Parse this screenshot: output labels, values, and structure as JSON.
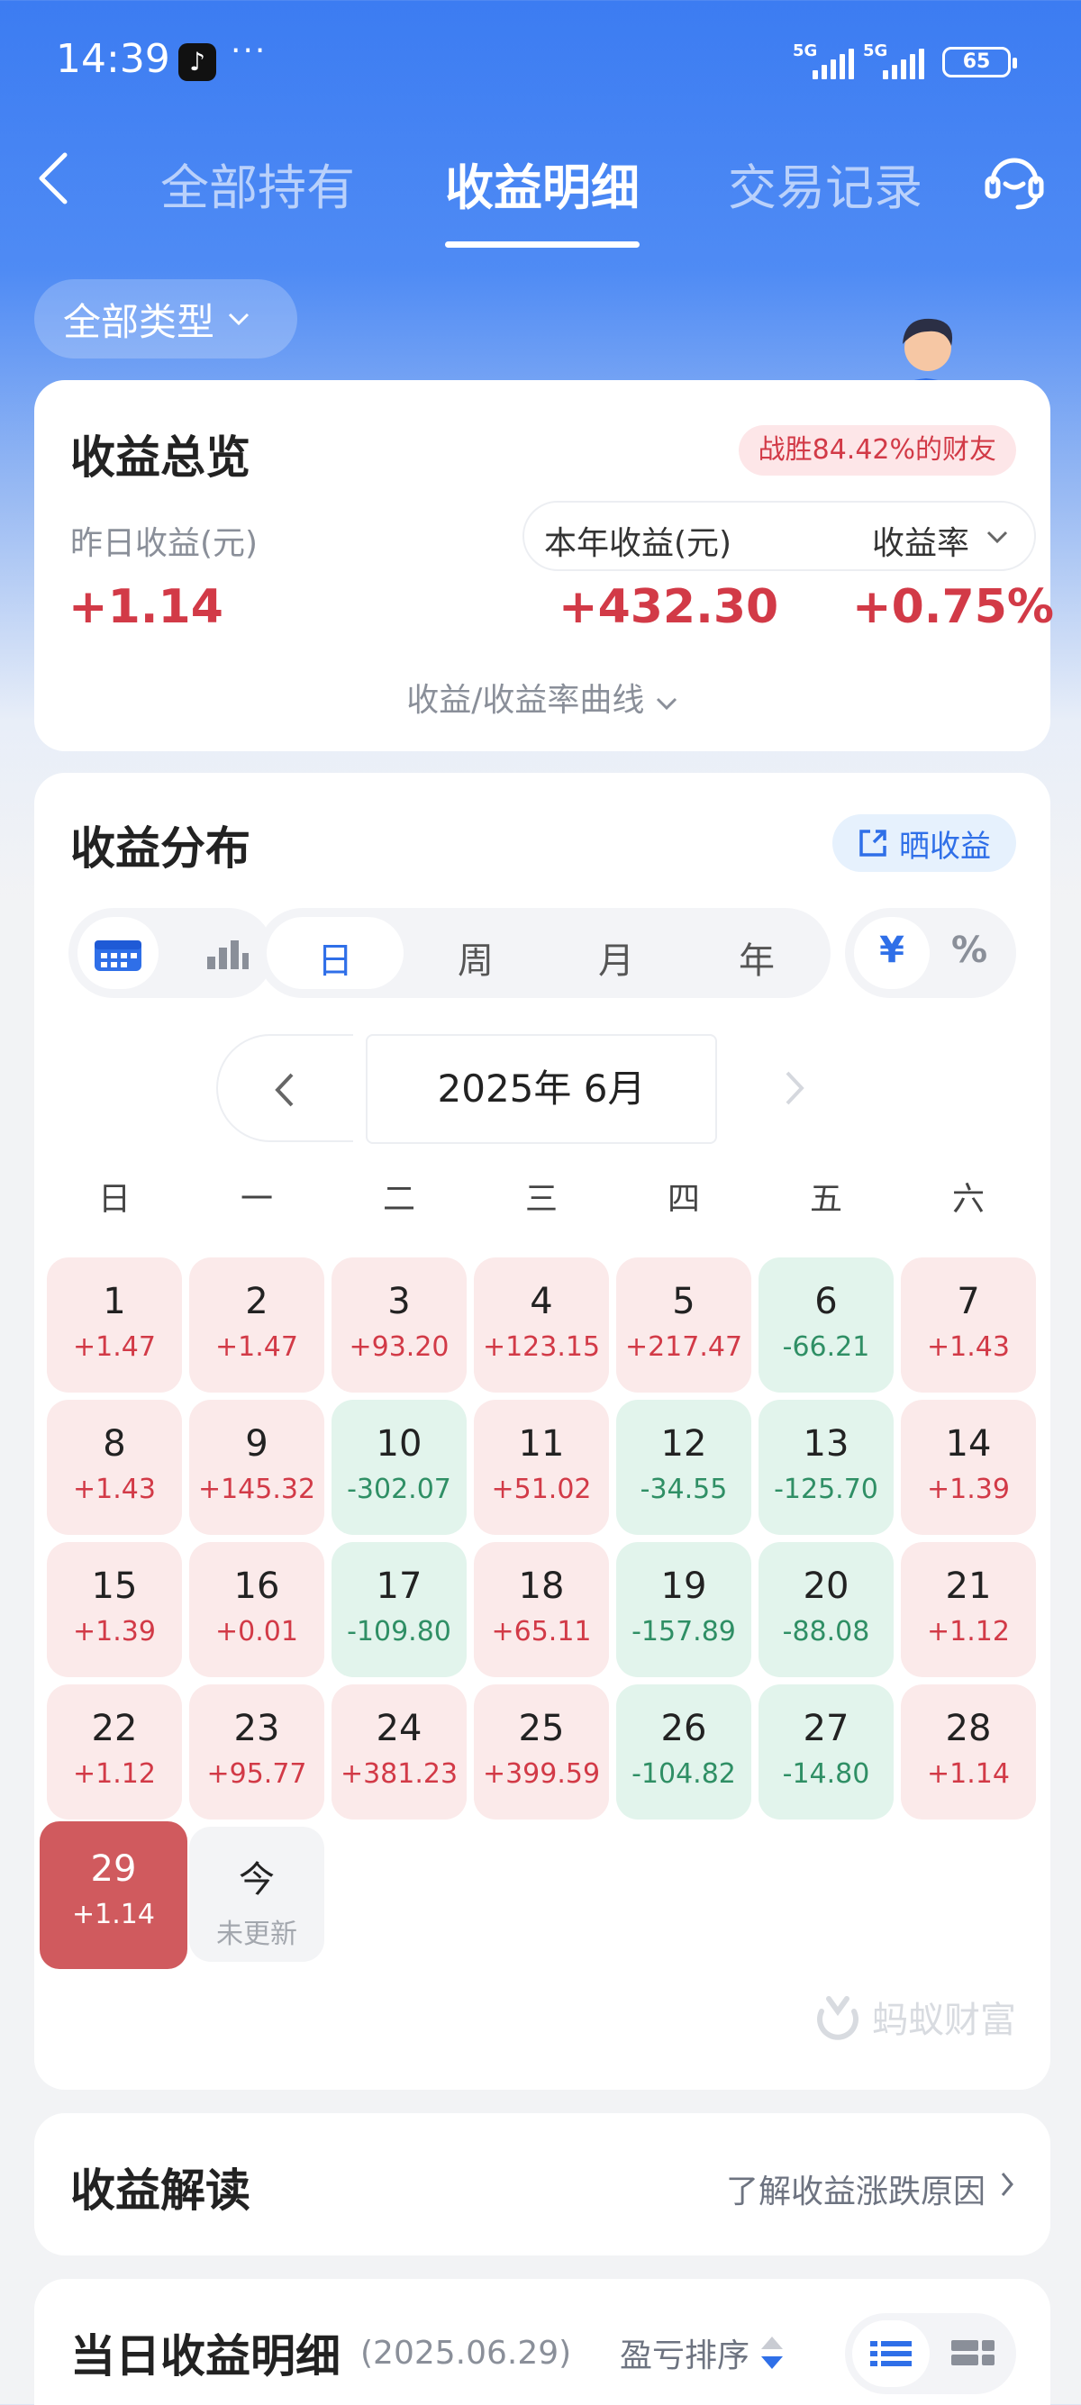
{
  "status_bar": {
    "time": "14:39",
    "dots": "···",
    "signal1": "5G",
    "signal2": "5G",
    "battery": "65"
  },
  "nav": {
    "tabs": [
      "全部持有",
      "收益明细",
      "交易记录"
    ],
    "active_index": 1
  },
  "type_filter": {
    "label": "全部类型"
  },
  "overview": {
    "title": "收益总览",
    "rank_badge": "战胜84.42%的财友",
    "yesterday_label": "昨日收益(元)",
    "yesterday_value": "+1.14",
    "year_label": "本年收益(元)",
    "year_value": "+432.30",
    "rate_label": "收益率",
    "rate_value": "+0.75%",
    "curve_label": "收益/收益率曲线"
  },
  "distribution": {
    "title": "收益分布",
    "share_label": "晒收益",
    "periods": [
      "日",
      "周",
      "月",
      "年"
    ],
    "active_period": "日",
    "units": [
      "¥",
      "%"
    ],
    "month_label": "2025年 6月",
    "weekdays": [
      "日",
      "一",
      "二",
      "三",
      "四",
      "五",
      "六"
    ],
    "days": [
      {
        "day": "1",
        "value": "+1.47",
        "trend": "pos"
      },
      {
        "day": "2",
        "value": "+1.47",
        "trend": "pos"
      },
      {
        "day": "3",
        "value": "+93.20",
        "trend": "pos"
      },
      {
        "day": "4",
        "value": "+123.15",
        "trend": "pos"
      },
      {
        "day": "5",
        "value": "+217.47",
        "trend": "pos"
      },
      {
        "day": "6",
        "value": "-66.21",
        "trend": "neg"
      },
      {
        "day": "7",
        "value": "+1.43",
        "trend": "pos"
      },
      {
        "day": "8",
        "value": "+1.43",
        "trend": "pos"
      },
      {
        "day": "9",
        "value": "+145.32",
        "trend": "pos"
      },
      {
        "day": "10",
        "value": "-302.07",
        "trend": "neg"
      },
      {
        "day": "11",
        "value": "+51.02",
        "trend": "pos"
      },
      {
        "day": "12",
        "value": "-34.55",
        "trend": "neg"
      },
      {
        "day": "13",
        "value": "-125.70",
        "trend": "neg"
      },
      {
        "day": "14",
        "value": "+1.39",
        "trend": "pos"
      },
      {
        "day": "15",
        "value": "+1.39",
        "trend": "pos"
      },
      {
        "day": "16",
        "value": "+0.01",
        "trend": "pos"
      },
      {
        "day": "17",
        "value": "-109.80",
        "trend": "neg"
      },
      {
        "day": "18",
        "value": "+65.11",
        "trend": "pos"
      },
      {
        "day": "19",
        "value": "-157.89",
        "trend": "neg"
      },
      {
        "day": "20",
        "value": "-88.08",
        "trend": "neg"
      },
      {
        "day": "21",
        "value": "+1.12",
        "trend": "pos"
      },
      {
        "day": "22",
        "value": "+1.12",
        "trend": "pos"
      },
      {
        "day": "23",
        "value": "+95.77",
        "trend": "pos"
      },
      {
        "day": "24",
        "value": "+381.23",
        "trend": "pos"
      },
      {
        "day": "25",
        "value": "+399.59",
        "trend": "pos"
      },
      {
        "day": "26",
        "value": "-104.82",
        "trend": "neg"
      },
      {
        "day": "27",
        "value": "-14.80",
        "trend": "neg"
      },
      {
        "day": "28",
        "value": "+1.14",
        "trend": "pos"
      },
      {
        "day": "29",
        "value": "+1.14",
        "trend": "selected"
      },
      {
        "day": "今",
        "value": "未更新",
        "trend": "pending"
      }
    ],
    "watermark": "蚂蚁财富"
  },
  "interpretation": {
    "title": "收益解读",
    "link": "了解收益涨跌原因"
  },
  "detail": {
    "title": "当日收益明细",
    "date": "(2025.06.29)",
    "sort_label": "盈亏排序"
  },
  "colors": {
    "brand_blue": "#3c7cf2",
    "gain_red": "#d23a47",
    "loss_green": "#2f8f65"
  }
}
